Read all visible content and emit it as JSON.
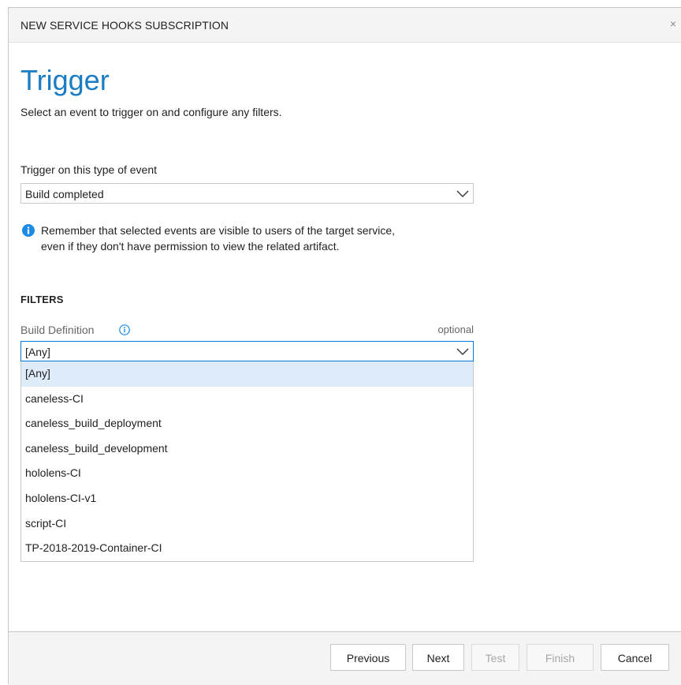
{
  "dialog": {
    "title": "NEW SERVICE HOOKS SUBSCRIPTION",
    "close_label": "×"
  },
  "page": {
    "heading": "Trigger",
    "subtitle": "Select an event to trigger on and configure any filters."
  },
  "event_type": {
    "label": "Trigger on this type of event",
    "selected": "Build completed"
  },
  "notice": {
    "line1": "Remember that selected events are visible to users of the target service,",
    "line2": "even if they don't have permission to view the related artifact."
  },
  "filters": {
    "header": "FILTERS",
    "build_definition": {
      "label": "Build Definition",
      "optional_label": "optional",
      "selected": "[Any]",
      "options": [
        "[Any]",
        "caneless-CI",
        "caneless_build_deployment",
        "caneless_build_development",
        "hololens-CI",
        "hololens-CI-v1",
        "script-CI",
        "TP-2018-2019-Container-CI"
      ]
    }
  },
  "footer": {
    "previous_label": "Previous",
    "next_label": "Next",
    "test_label": "Test",
    "finish_label": "Finish",
    "cancel_label": "Cancel"
  },
  "colors": {
    "accent": "#1a7dc4",
    "info_icon": "#1a8ae5",
    "selected_row": "#deecf9",
    "focus_border": "#0078d4"
  },
  "icons": {
    "close": "close-icon",
    "chevron": "chevron-down-icon",
    "info": "info-icon"
  }
}
